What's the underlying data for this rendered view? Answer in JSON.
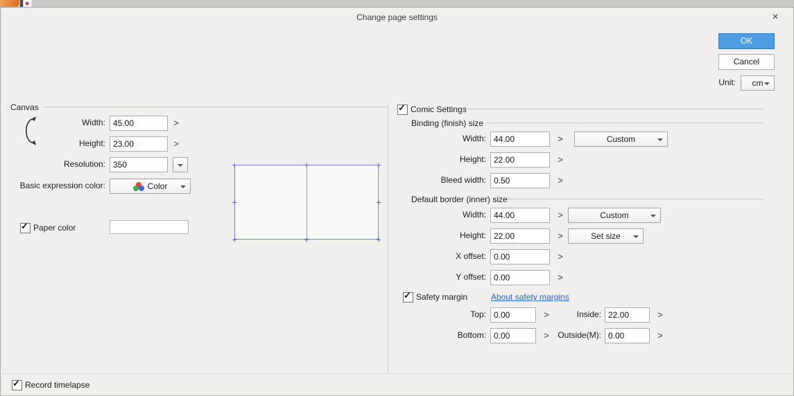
{
  "app": {
    "title": "Change page settings"
  },
  "icons": {
    "close": "×",
    "check": "✓",
    "chevron_right": ">",
    "plus": "+"
  },
  "colors": {
    "accent_blue": "#4f9ce2",
    "link_blue": "#2964c8",
    "guide_blue": "#5a66c2"
  },
  "actions": {
    "ok": "OK",
    "cancel": "Cancel"
  },
  "unit": {
    "label": "Unit:",
    "value": "cm"
  },
  "canvas": {
    "group_label": "Canvas",
    "width": {
      "label": "Width:",
      "value": "45.00"
    },
    "height": {
      "label": "Height:",
      "value": "23.00"
    },
    "resolution": {
      "label": "Resolution:",
      "value": "350"
    },
    "expression": {
      "label": "Basic expression color:",
      "value": "Color"
    },
    "paper_color": {
      "label": "Paper color"
    }
  },
  "comic": {
    "group_label": "Comic Settings",
    "binding": {
      "group_label": "Binding (finish) size",
      "width": {
        "label": "Width:",
        "value": "44.00",
        "preset": "Custom"
      },
      "height": {
        "label": "Height:",
        "value": "22.00"
      },
      "bleed": {
        "label": "Bleed width:",
        "value": "0.50"
      }
    },
    "border": {
      "group_label": "Default border (inner) size",
      "width": {
        "label": "Width:",
        "value": "44.00",
        "preset": "Custom"
      },
      "height": {
        "label": "Height:",
        "value": "22.00",
        "mode": "Set size"
      },
      "x_offset": {
        "label": "X offset:",
        "value": "0.00"
      },
      "y_offset": {
        "label": "Y offset:",
        "value": "0.00"
      }
    },
    "safety": {
      "label": "Safety margin",
      "link": "About safety margins",
      "top": {
        "label": "Top:",
        "value": "0.00"
      },
      "inside": {
        "label": "Inside:",
        "value": "22.00"
      },
      "bottom": {
        "label": "Bottom:",
        "value": "0.00"
      },
      "outside": {
        "label": "Outside(M):",
        "value": "0.00"
      }
    }
  },
  "footer": {
    "record_timelapse": "Record timelapse"
  }
}
